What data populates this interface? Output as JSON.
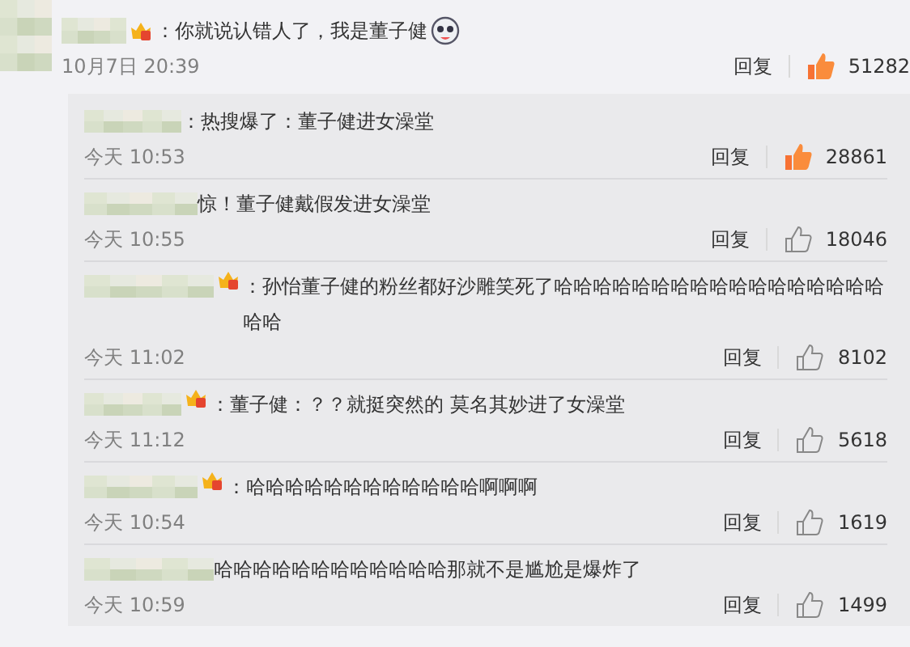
{
  "comment": {
    "text": "：你就说认错人了，我是董子健",
    "badge": true,
    "emoji": true,
    "time": "10月7日 20:39",
    "reply_label": "回复",
    "liked": true,
    "likes": "51282"
  },
  "replies": [
    {
      "text": "：热搜爆了：董子健进女澡堂",
      "badge": false,
      "time": "今天 10:53",
      "reply_label": "回复",
      "liked": true,
      "likes": "28861"
    },
    {
      "text": "惊！董子健戴假发进女澡堂",
      "badge": false,
      "time": "今天 10:55",
      "reply_label": "回复",
      "liked": false,
      "likes": "18046"
    },
    {
      "text": "：孙怡董子健的粉丝都好沙雕笑死了哈哈哈哈哈哈哈哈哈哈哈哈哈哈哈哈哈哈哈",
      "badge": true,
      "time": "今天 11:02",
      "reply_label": "回复",
      "liked": false,
      "likes": "8102"
    },
    {
      "text": "：董子健：？？就挺突然的 莫名其妙进了女澡堂",
      "badge": true,
      "time": "今天 11:12",
      "reply_label": "回复",
      "liked": false,
      "likes": "5618"
    },
    {
      "text": "：哈哈哈哈哈哈哈哈哈哈哈哈啊啊啊",
      "badge": true,
      "time": "今天 10:54",
      "reply_label": "回复",
      "liked": false,
      "likes": "1619"
    },
    {
      "text": "哈哈哈哈哈哈哈哈哈哈哈哈那就不是尴尬是爆炸了",
      "badge": false,
      "time": "今天 10:59",
      "reply_label": "回复",
      "liked": false,
      "likes": "1499"
    }
  ]
}
